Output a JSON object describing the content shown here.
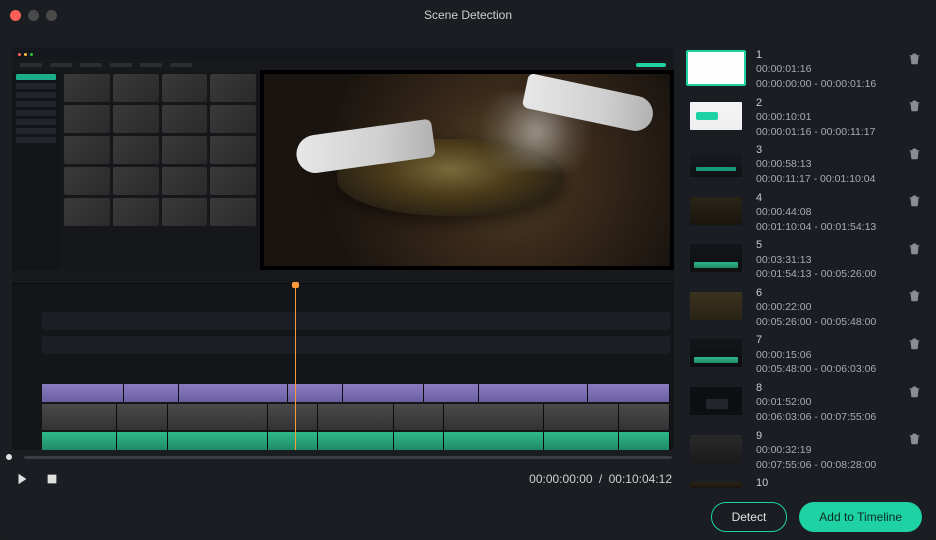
{
  "window": {
    "title": "Scene Detection"
  },
  "transport": {
    "current_time": "00:00:00:00",
    "total_time": "00:10:04:12",
    "time_separator": "/"
  },
  "scenes": [
    {
      "index": "1",
      "duration": "00:00:01:16",
      "range": "00:00:00:00 - 00:00:01:16"
    },
    {
      "index": "2",
      "duration": "00:00:10:01",
      "range": "00:00:01:16 - 00:00:11:17"
    },
    {
      "index": "3",
      "duration": "00:00:58:13",
      "range": "00:00:11:17 - 00:01:10:04"
    },
    {
      "index": "4",
      "duration": "00:00:44:08",
      "range": "00:01:10:04 - 00:01:54:13"
    },
    {
      "index": "5",
      "duration": "00:03:31:13",
      "range": "00:01:54:13 - 00:05:26:00"
    },
    {
      "index": "6",
      "duration": "00:00:22:00",
      "range": "00:05:26:00 - 00:05:48:00"
    },
    {
      "index": "7",
      "duration": "00:00:15:06",
      "range": "00:05:48:00 - 00:06:03:06"
    },
    {
      "index": "8",
      "duration": "00:01:52:00",
      "range": "00:06:03:06 - 00:07:55:06"
    },
    {
      "index": "9",
      "duration": "00:00:32:19",
      "range": "00:07:55:06 - 00:08:28:00"
    },
    {
      "index": "10",
      "duration": "",
      "range": ""
    }
  ],
  "buttons": {
    "detect": "Detect",
    "add_to_timeline": "Add to Timeline"
  }
}
